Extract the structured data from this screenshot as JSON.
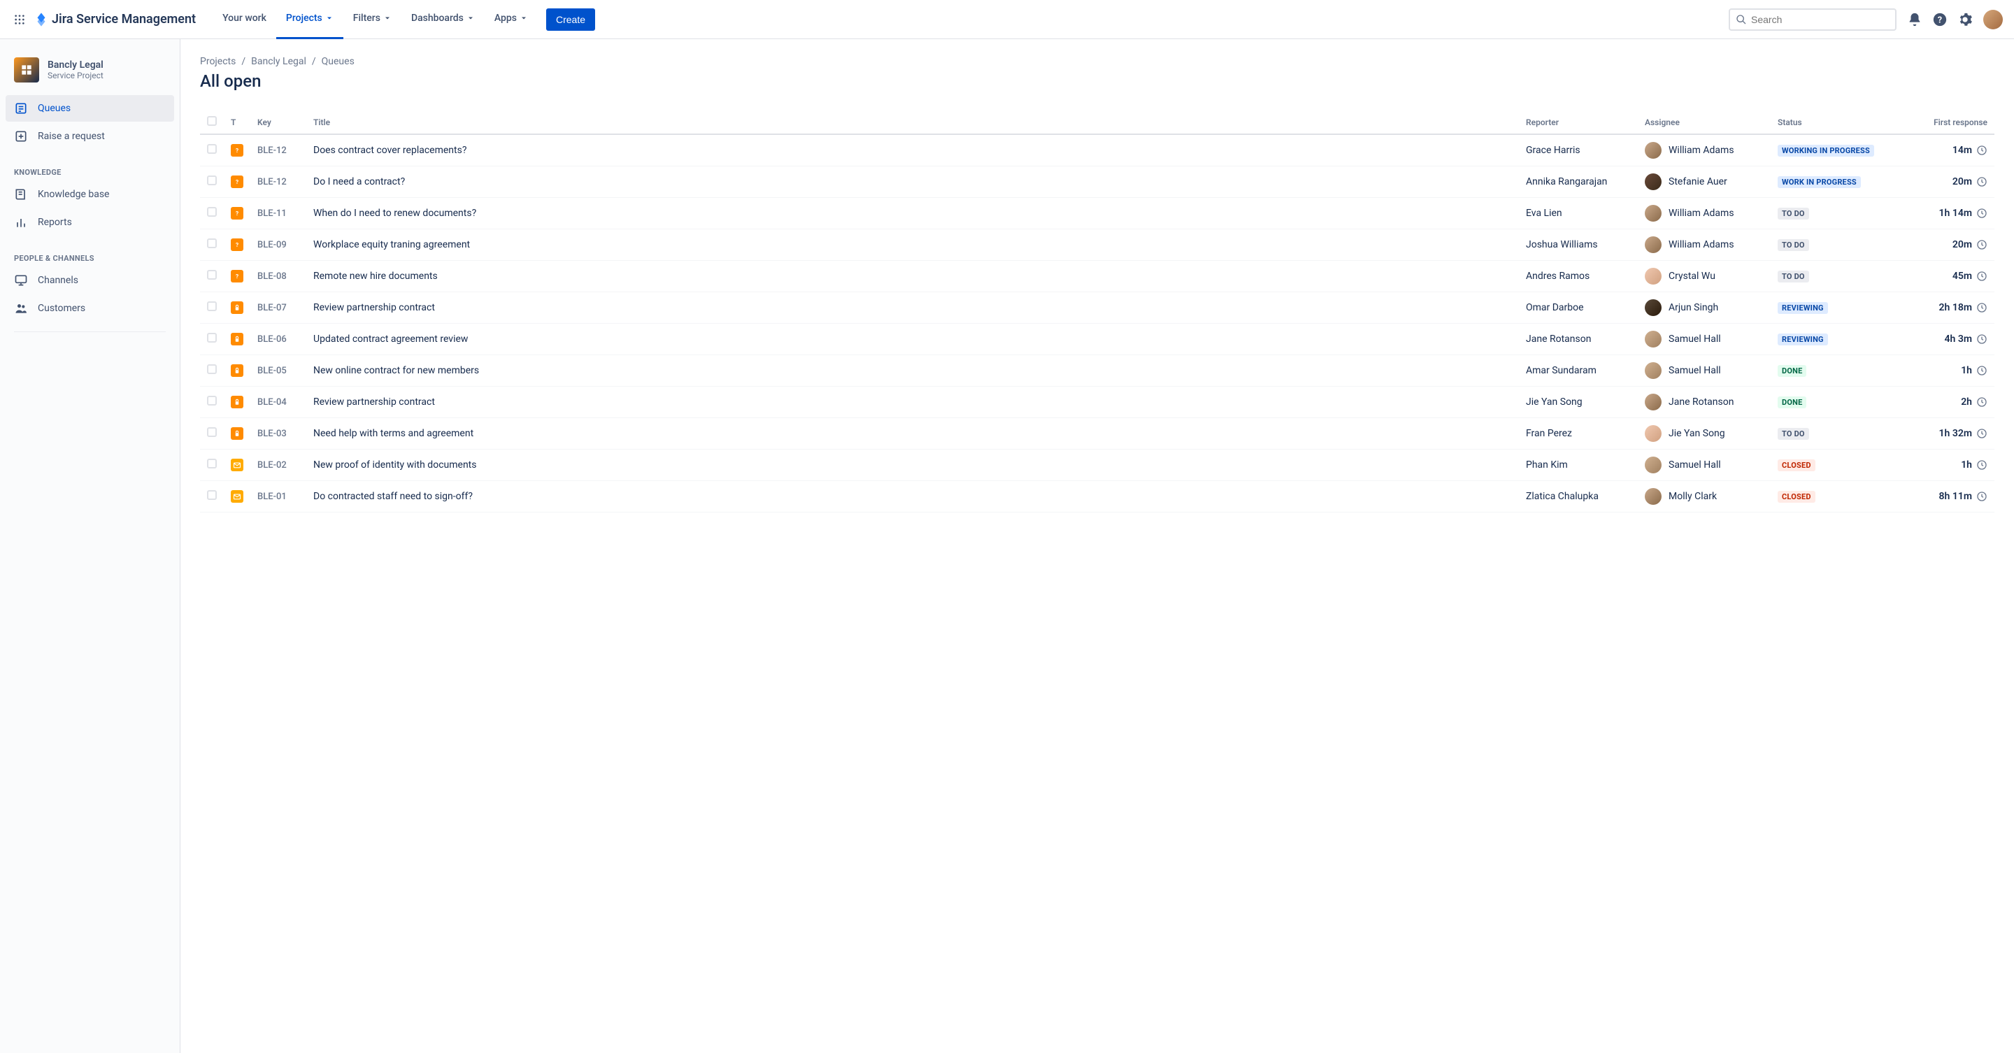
{
  "header": {
    "product": "Jira Service Management",
    "nav": {
      "your_work": "Your work",
      "projects": "Projects",
      "filters": "Filters",
      "dashboards": "Dashboards",
      "apps": "Apps"
    },
    "create": "Create",
    "search_placeholder": "Search"
  },
  "sidebar": {
    "project_name": "Bancly Legal",
    "project_sub": "Service Project",
    "items": {
      "queues": "Queues",
      "raise": "Raise a request",
      "knowledge_section": "KNOWLEDGE",
      "kb": "Knowledge base",
      "reports": "Reports",
      "people_section": "PEOPLE & CHANNELS",
      "channels": "Channels",
      "customers": "Customers"
    }
  },
  "breadcrumbs": {
    "projects": "Projects",
    "project": "Bancly Legal",
    "queues": "Queues"
  },
  "page_title": "All open",
  "columns": {
    "t": "T",
    "key": "Key",
    "title": "Title",
    "reporter": "Reporter",
    "assignee": "Assignee",
    "status": "Status",
    "first_response": "First response"
  },
  "rows": [
    {
      "type": "q",
      "key": "BLE-12",
      "title": "Does contract cover replacements?",
      "reporter": "Grace Harris",
      "assignee": "William Adams",
      "status": "WORKING IN PROGRESS",
      "status_class": "st-inprogress",
      "resp": "14m",
      "av": "av0"
    },
    {
      "type": "q",
      "key": "BLE-12",
      "title": "Do I need a contract?",
      "reporter": "Annika Rangarajan",
      "assignee": "Stefanie Auer",
      "status": "WORK IN PROGRESS",
      "status_class": "st-inprogress",
      "resp": "20m",
      "av": "av1"
    },
    {
      "type": "q",
      "key": "BLE-11",
      "title": "When do I need to renew documents?",
      "reporter": "Eva Lien",
      "assignee": "William Adams",
      "status": "TO DO",
      "status_class": "st-todo",
      "resp": "1h 14m",
      "av": "av0"
    },
    {
      "type": "q",
      "key": "BLE-09",
      "title": "Workplace equity traning agreement",
      "reporter": "Joshua Williams",
      "assignee": "William Adams",
      "status": "TO DO",
      "status_class": "st-todo",
      "resp": "20m",
      "av": "av0"
    },
    {
      "type": "q",
      "key": "BLE-08",
      "title": "Remote new hire documents",
      "reporter": "Andres Ramos",
      "assignee": "Crystal Wu",
      "status": "TO DO",
      "status_class": "st-todo",
      "resp": "45m",
      "av": "av2"
    },
    {
      "type": "l",
      "key": "BLE-07",
      "title": "Review partnership contract",
      "reporter": "Omar Darboe",
      "assignee": "Arjun Singh",
      "status": "REVIEWING",
      "status_class": "st-reviewing",
      "resp": "2h 18m",
      "av": "av3"
    },
    {
      "type": "l",
      "key": "BLE-06",
      "title": "Updated contract agreement review",
      "reporter": "Jane Rotanson",
      "assignee": "Samuel Hall",
      "status": "REVIEWING",
      "status_class": "st-reviewing",
      "resp": "4h 3m",
      "av": "av4"
    },
    {
      "type": "l",
      "key": "BLE-05",
      "title": "New online contract for new members",
      "reporter": "Amar Sundaram",
      "assignee": "Samuel Hall",
      "status": "DONE",
      "status_class": "st-done",
      "resp": "1h",
      "av": "av4"
    },
    {
      "type": "l",
      "key": "BLE-04",
      "title": "Review partnership contract",
      "reporter": "Jie Yan Song",
      "assignee": "Jane Rotanson",
      "status": "DONE",
      "status_class": "st-done",
      "resp": "2h",
      "av": "av0"
    },
    {
      "type": "l",
      "key": "BLE-03",
      "title": "Need help with terms and agreement",
      "reporter": "Fran Perez",
      "assignee": "Jie Yan Song",
      "status": "TO DO",
      "status_class": "st-todo",
      "resp": "1h 32m",
      "av": "av2"
    },
    {
      "type": "m",
      "key": "BLE-02",
      "title": "New proof of identity with documents",
      "reporter": "Phan Kim",
      "assignee": "Samuel Hall",
      "status": "CLOSED",
      "status_class": "st-closed",
      "resp": "1h",
      "av": "av4"
    },
    {
      "type": "m",
      "key": "BLE-01",
      "title": "Do contracted staff need to sign-off?",
      "reporter": "Zlatica Chalupka",
      "assignee": "Molly Clark",
      "status": "CLOSED",
      "status_class": "st-closed",
      "resp": "8h 11m",
      "av": "av0"
    }
  ]
}
